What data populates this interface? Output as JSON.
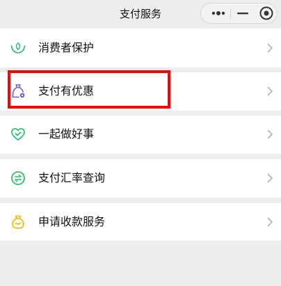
{
  "header": {
    "title": "支付服务",
    "capsule_icons": [
      "more-icon",
      "minimize-icon",
      "close-icon"
    ]
  },
  "menu": {
    "items": [
      {
        "label": "消费者保护",
        "icon": "hands-leaf-icon",
        "icon_color": "#3dbb7a"
      },
      {
        "label": "支付有优惠",
        "icon": "coupon-bag-icon",
        "icon_color": "#6b5bd6",
        "highlighted": true
      },
      {
        "label": "一起做好事",
        "icon": "heart-icon",
        "icon_color": "#2fbf71"
      },
      {
        "label": "支付汇率查询",
        "icon": "exchange-icon",
        "icon_color": "#2fbf71"
      },
      {
        "label": "申请收款服务",
        "icon": "money-bag-icon",
        "icon_color": "#f2b705"
      }
    ]
  },
  "colors": {
    "background": "#ededed",
    "row_background": "#ffffff",
    "highlight_border": "#ff0000"
  }
}
